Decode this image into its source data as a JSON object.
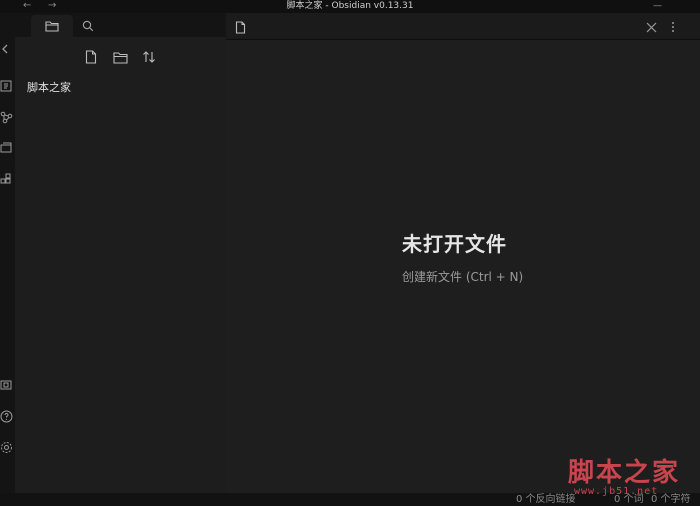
{
  "window": {
    "title": "脚本之家 - Obsidian v0.13.31",
    "back_glyph": "←",
    "forward_glyph": "→",
    "minimize_glyph": "—"
  },
  "ribbon": {
    "icons": [
      "collapse-sidebar-icon",
      "quick-switcher-icon",
      "graph-view-icon",
      "open-slides-icon",
      "plugins-icon",
      "vault-icon",
      "help-icon",
      "settings-icon"
    ]
  },
  "sidebar": {
    "tabs": [
      "file-explorer-tab",
      "search-tab"
    ],
    "toolbar": [
      "new-note-icon",
      "new-folder-icon",
      "sort-icon"
    ],
    "files": [
      {
        "name": "脚本之家"
      }
    ]
  },
  "main": {
    "empty_title": "未打开文件",
    "create_action": "创建新文件 (Ctrl + N)"
  },
  "status": {
    "backlinks": "0 个反向链接",
    "words": "0 个词",
    "chars": "0 个字符"
  },
  "watermark": {
    "text": "脚本之家",
    "url": "www.jb51.net",
    "color": "#c9454d"
  },
  "colors": {
    "background": "#1e1e1e",
    "sidebar": "#1d1d1d",
    "ribbon": "#141414",
    "text": "#dcddde",
    "muted": "#9a9a9a"
  }
}
